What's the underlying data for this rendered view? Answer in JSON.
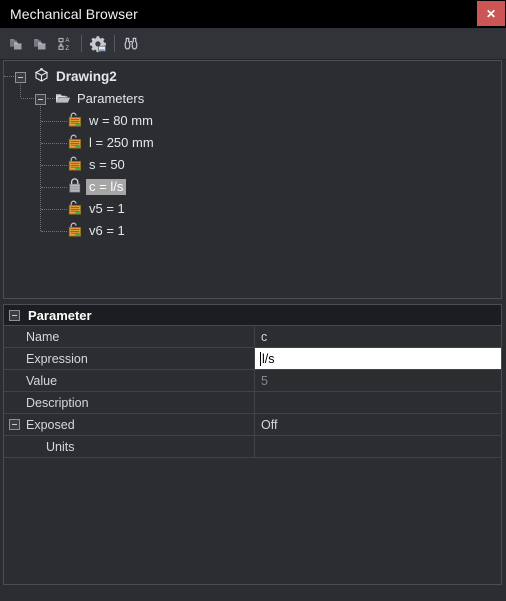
{
  "window": {
    "title": "Mechanical Browser",
    "close_label": "✕"
  },
  "toolbar": {
    "items": [
      {
        "name": "add-folder-icon",
        "tooltip": "Insert folder"
      },
      {
        "name": "add-subfolder-icon",
        "tooltip": "Insert subfolder"
      },
      {
        "name": "sort-az-icon",
        "tooltip": "Sort A-Z"
      },
      {
        "name": "settings-gear-icon",
        "tooltip": "Settings"
      },
      {
        "name": "find-binoculars-icon",
        "tooltip": "Find"
      }
    ]
  },
  "tree": {
    "root": {
      "label": "Drawing2",
      "icon": "cube-icon",
      "expanded": true
    },
    "folder": {
      "label": "Parameters",
      "icon": "folder-open-icon",
      "expanded": true
    },
    "parameters": [
      {
        "label": "w = 80 mm",
        "icon": "parameter-unlocked-icon",
        "selected": false
      },
      {
        "label": "l = 250 mm",
        "icon": "parameter-unlocked-icon",
        "selected": false
      },
      {
        "label": "s = 50",
        "icon": "parameter-unlocked-icon",
        "selected": false
      },
      {
        "label": "c = l/s",
        "icon": "parameter-locked-icon",
        "selected": true
      },
      {
        "label": "v5 = 1",
        "icon": "parameter-unlocked-icon",
        "selected": false
      },
      {
        "label": "v6 = 1",
        "icon": "parameter-unlocked-icon",
        "selected": false
      }
    ]
  },
  "properties": {
    "group_title": "Parameter",
    "rows": [
      {
        "label": "Name",
        "value": "c",
        "state": "normal",
        "indent": false
      },
      {
        "label": "Expression",
        "value": "l/s",
        "state": "editing",
        "indent": false
      },
      {
        "label": "Value",
        "value": "5",
        "state": "dim",
        "indent": false
      },
      {
        "label": "Description",
        "value": "",
        "state": "normal",
        "indent": false
      },
      {
        "label": "Exposed",
        "value": "Off",
        "state": "normal",
        "indent": false,
        "expander": true
      },
      {
        "label": "Units",
        "value": "",
        "state": "normal",
        "indent": true
      }
    ]
  },
  "colors": {
    "window_bg": "#2b2d31",
    "titlebar_bg": "#000000",
    "toolbar_bg": "#313338",
    "close_button": "#cc5555",
    "selection": "#a6a6a6",
    "param_icon": "#e8a33d",
    "param_icon_accent": "#3bb24a",
    "panel_border": "#4a4d53",
    "edit_field_bg": "#ffffff"
  }
}
